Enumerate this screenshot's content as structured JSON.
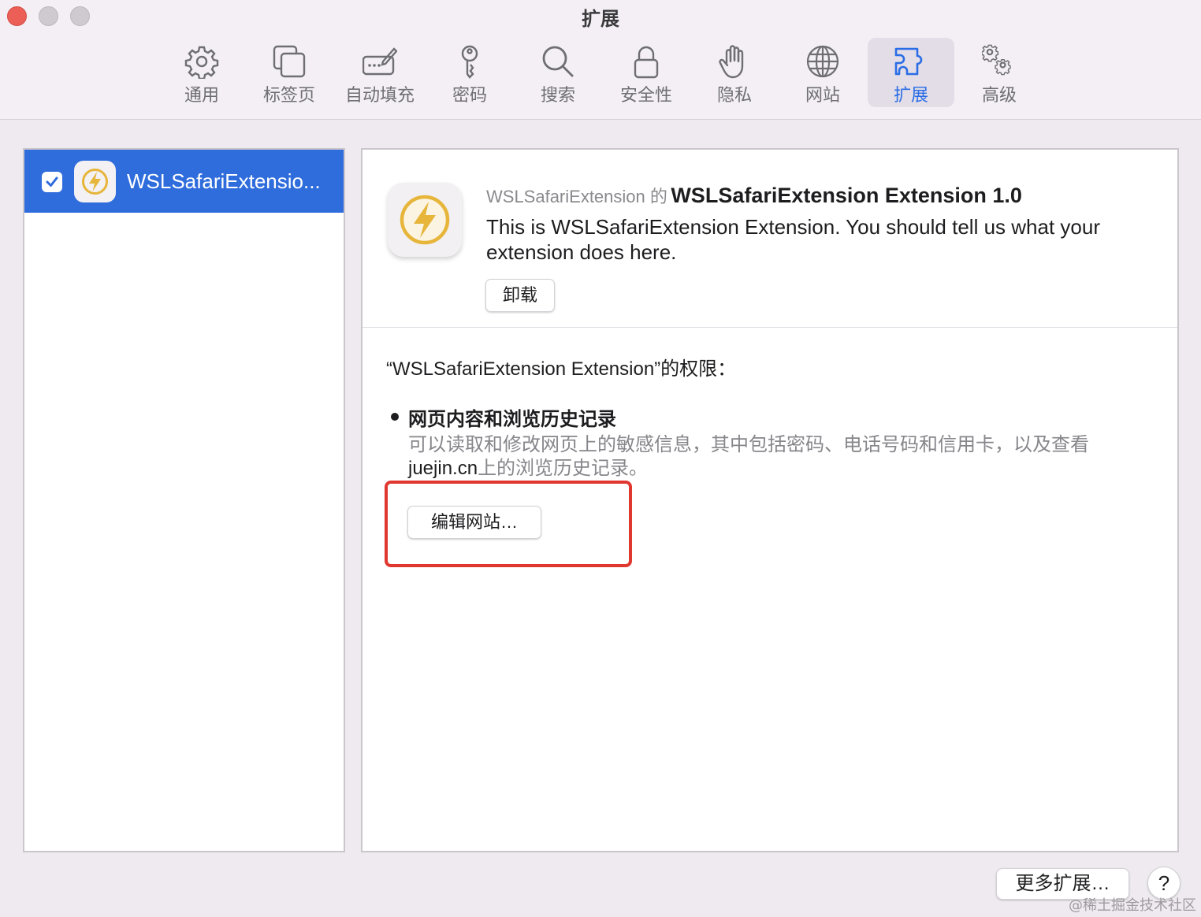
{
  "window": {
    "title": "扩展"
  },
  "toolbar": {
    "items": [
      {
        "label": "通用",
        "icon": "gear-icon"
      },
      {
        "label": "标签页",
        "icon": "tabs-icon"
      },
      {
        "label": "自动填充",
        "icon": "autofill-icon"
      },
      {
        "label": "密码",
        "icon": "key-icon"
      },
      {
        "label": "搜索",
        "icon": "search-icon"
      },
      {
        "label": "安全性",
        "icon": "lock-icon"
      },
      {
        "label": "隐私",
        "icon": "hand-icon"
      },
      {
        "label": "网站",
        "icon": "globe-icon"
      },
      {
        "label": "扩展",
        "icon": "puzzle-icon",
        "active": true
      },
      {
        "label": "高级",
        "icon": "gears-icon"
      }
    ],
    "active_color": "#2a6de6"
  },
  "sidebar": {
    "items": [
      {
        "label": "WSLSafariExtensio...",
        "checked": true,
        "icon": "lightning-icon"
      }
    ],
    "selected_color": "#2f6cdc"
  },
  "detail": {
    "developer": "WSLSafariExtension 的",
    "name": "WSLSafariExtension Extension 1.0",
    "description": "This is WSLSafariExtension Extension. You should tell us what your extension does here.",
    "uninstall_label": "卸载",
    "permissions_heading": "“WSLSafariExtension Extension”的权限：",
    "permission": {
      "title": "网页内容和浏览历史记录",
      "desc_prefix": "可以读取和修改网页上的敏感信息，其中包括密码、电话号码和信用卡，以及查看",
      "domain": "juejin.cn",
      "desc_suffix": "上的浏览历史记录。"
    },
    "edit_sites_label": "编辑网站…",
    "highlight_color": "#e0372e"
  },
  "footer": {
    "more_extensions_label": "更多扩展…",
    "help_label": "?",
    "watermark": "@稀土掘金技术社区"
  }
}
